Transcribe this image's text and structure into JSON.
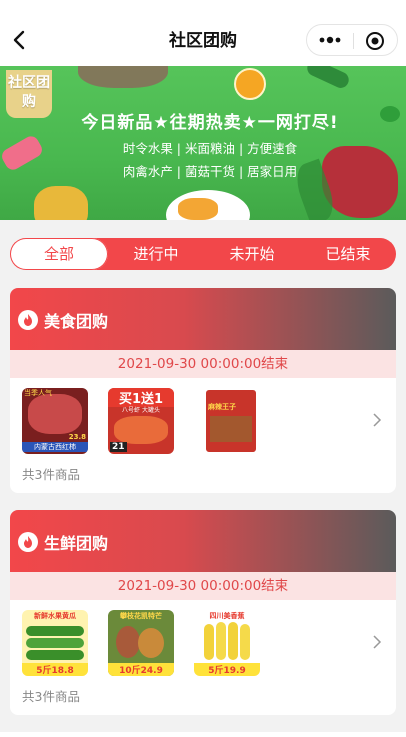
{
  "nav": {
    "title": "社区团购",
    "back_icon": "chevron-left-icon",
    "more_icon": "more-dots-icon",
    "close_icon": "target-close-icon"
  },
  "banner": {
    "tag": "社区团购",
    "headline": "今日新品★往期热卖★一网打尽!",
    "line1": "时令水果 | 米面粮油 | 方便速食",
    "line2": "肉禽水产 | 菌菇干货 | 居家日用"
  },
  "tabs": [
    {
      "label": "全部",
      "active": true
    },
    {
      "label": "进行中",
      "active": false
    },
    {
      "label": "未开始",
      "active": false
    },
    {
      "label": "已结束",
      "active": false
    }
  ],
  "groups": [
    {
      "name": "美食团购",
      "end_time": "2021-09-30 00:00:00结束",
      "count_text": "共3件商品",
      "thumbs": [
        {
          "top": "当季人气",
          "bottom": "内蒙古西红柿",
          "price": "23.8"
        },
        {
          "top": "买1送1",
          "sub": "八号虾  大罐头",
          "price": "21"
        },
        {
          "top": "麻辣王子"
        }
      ]
    },
    {
      "name": "生鲜团购",
      "end_time": "2021-09-30 00:00:00结束",
      "count_text": "共3件商品",
      "thumbs": [
        {
          "top": "新鲜水果黄瓜",
          "price": "5斤18.8"
        },
        {
          "top": "攀枝花凯特芒",
          "price": "10斤24.9"
        },
        {
          "top": "四川美香蕉",
          "price": "5斤19.9"
        }
      ]
    }
  ],
  "colors": {
    "accent": "#f2474a",
    "banner_green": "#4cbb50",
    "date_bg": "#fbe3e3"
  }
}
